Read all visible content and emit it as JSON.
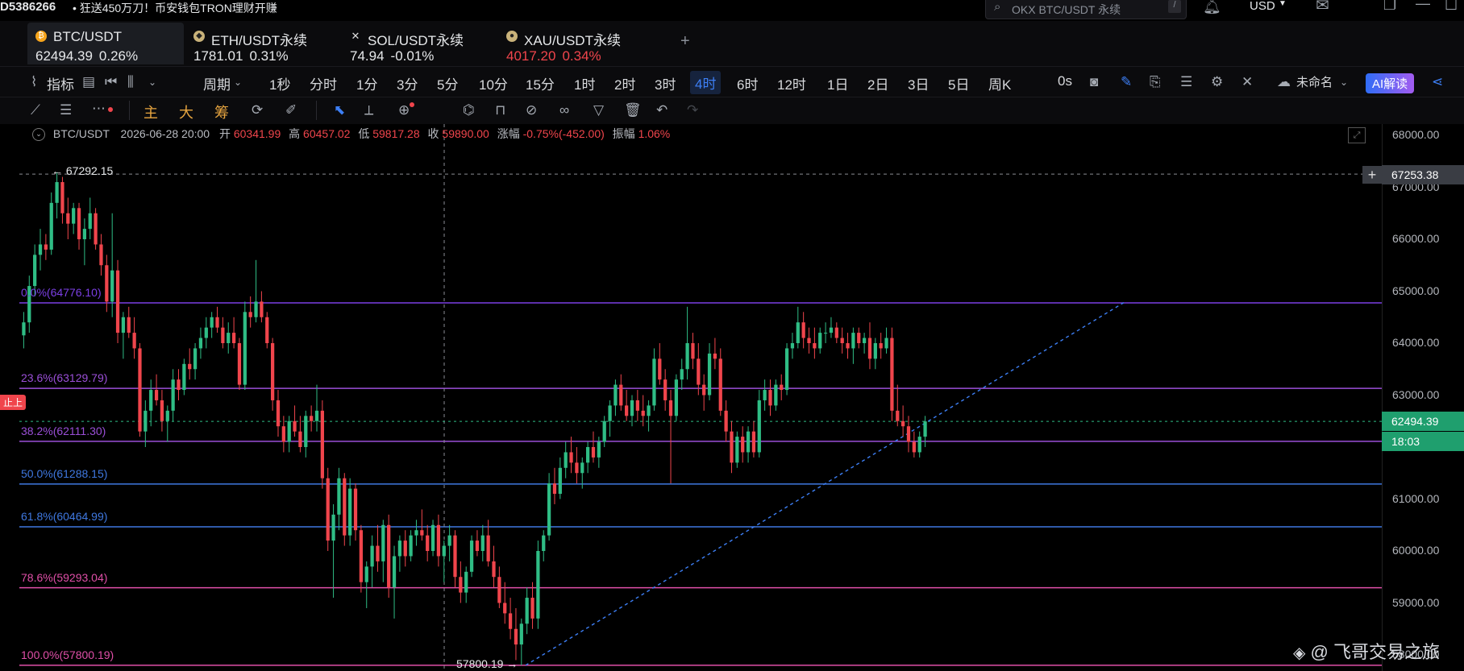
{
  "topbar": {
    "account_fragment": "D5386266",
    "promo": "• 狂送450万刀！币安钱包TRON理财开赚",
    "search_placeholder": "OKX BTC/USDT 永续",
    "search_shortcut": "/",
    "currency": "USD"
  },
  "tabs": [
    {
      "name": "BTC/USDT",
      "price": "62494.39",
      "change": "0.26%",
      "change_color": "#2fbd85",
      "active": true
    },
    {
      "name": "ETH/USDT永续",
      "price": "1781.01",
      "change": "0.31%",
      "change_color": "#2fbd85",
      "active": false
    },
    {
      "name": "SOL/USDT永续",
      "price": "74.94",
      "change": "-0.01%",
      "change_color": "#f0454c",
      "active": false
    },
    {
      "name": "XAU/USDT永续",
      "price": "4017.20",
      "change": "0.34%",
      "change_color": "#2fbd85",
      "active": false
    }
  ],
  "toolbar": {
    "indicators_label": "指标",
    "period_label": "周期",
    "timeframes": [
      "1秒",
      "分时",
      "1分",
      "3分",
      "5分",
      "10分",
      "15分",
      "1时",
      "2时",
      "3时",
      "4时",
      "6时",
      "12时",
      "1日",
      "2日",
      "3日",
      "5日",
      "周K"
    ],
    "active_timeframe": "4时",
    "countdown": "0s",
    "layout_name": "未命名",
    "ai_label": "AI解读",
    "drawing_labels": [
      "主",
      "大",
      "筹"
    ]
  },
  "infobar": {
    "symbol": "BTC/USDT",
    "datetime": "2026-06-28 20:00",
    "open_label": "开",
    "open": "60341.99",
    "high_label": "高",
    "high": "60457.02",
    "low_label": "低",
    "low": "59817.28",
    "close_label": "收",
    "close": "59890.00",
    "change_label": "涨幅",
    "change": "-0.75%(-452.00)",
    "amplitude_label": "振幅",
    "amplitude": "1.06%"
  },
  "chart_annotations": {
    "high_marker": "67292.15",
    "low_marker": "57800.19",
    "crosshair_price": "67253.38",
    "last_price": "62494.39",
    "countdown": "18:03",
    "side_badge": "止上",
    "watermark": "@ 飞哥交易之旅"
  },
  "fib_levels": [
    {
      "label": "0.0%(64776.10)",
      "price": 64776.1,
      "color": "#7b3fe4"
    },
    {
      "label": "23.6%(63129.79)",
      "price": 63129.79,
      "color": "#9b4fd8"
    },
    {
      "label": "38.2%(62111.30)",
      "price": 62111.3,
      "color": "#9b4fd8"
    },
    {
      "label": "50.0%(61288.15)",
      "price": 61288.15,
      "color": "#3f78e0"
    },
    {
      "label": "61.8%(60464.99)",
      "price": 60464.99,
      "color": "#3f78e0"
    },
    {
      "label": "78.6%(59293.04)",
      "price": 59293.04,
      "color": "#e04fa8"
    },
    {
      "label": "100.0%(57800.19)",
      "price": 57800.19,
      "color": "#e04fa8"
    }
  ],
  "price_axis": [
    "68000.00",
    "67000.00",
    "66000.00",
    "65000.00",
    "64000.00",
    "63000.00",
    "62000.00",
    "61000.00",
    "60000.00",
    "59000.00",
    "58000.00"
  ],
  "colors": {
    "up": "#2fbd85",
    "down": "#f0454c",
    "accent": "#3d7ff5"
  },
  "candles": [
    [
      64150,
      64600,
      63900,
      64400
    ],
    [
      64400,
      65300,
      64200,
      65100
    ],
    [
      65100,
      65900,
      64900,
      65700
    ],
    [
      65700,
      66200,
      65400,
      65900
    ],
    [
      65900,
      66100,
      65600,
      65800
    ],
    [
      65800,
      66900,
      65700,
      66700
    ],
    [
      66700,
      67292,
      66400,
      67100
    ],
    [
      67100,
      67200,
      66300,
      66500
    ],
    [
      66500,
      66800,
      66000,
      66300
    ],
    [
      66300,
      66700,
      66100,
      66600
    ],
    [
      66600,
      66700,
      65800,
      66000
    ],
    [
      66000,
      66400,
      65500,
      66200
    ],
    [
      66200,
      66800,
      66000,
      66500
    ],
    [
      66500,
      66600,
      65800,
      65900
    ],
    [
      65900,
      66100,
      65300,
      65500
    ],
    [
      65500,
      65700,
      64600,
      64800
    ],
    [
      64800,
      66500,
      64500,
      65400
    ],
    [
      65400,
      65600,
      64000,
      64200
    ],
    [
      64200,
      64600,
      63700,
      64500
    ],
    [
      64500,
      64700,
      64100,
      64200
    ],
    [
      64200,
      64500,
      63700,
      63900
    ],
    [
      63900,
      64000,
      62200,
      62300
    ],
    [
      62300,
      62900,
      62000,
      62700
    ],
    [
      62700,
      63300,
      62400,
      63100
    ],
    [
      63100,
      63400,
      62800,
      62900
    ],
    [
      62900,
      63100,
      62300,
      62500
    ],
    [
      62500,
      62800,
      62100,
      62700
    ],
    [
      62700,
      63500,
      62500,
      63300
    ],
    [
      63300,
      63500,
      62900,
      63100
    ],
    [
      63100,
      63700,
      63000,
      63600
    ],
    [
      63600,
      63900,
      63300,
      63500
    ],
    [
      63500,
      64000,
      63300,
      63900
    ],
    [
      63900,
      64300,
      63700,
      64100
    ],
    [
      64100,
      64500,
      63900,
      64300
    ],
    [
      64300,
      64600,
      64100,
      64500
    ],
    [
      64500,
      64700,
      64200,
      64300
    ],
    [
      64300,
      64500,
      63900,
      64000
    ],
    [
      64000,
      64400,
      63800,
      64200
    ],
    [
      64200,
      64500,
      63900,
      64000
    ],
    [
      64000,
      64100,
      63100,
      63200
    ],
    [
      63200,
      64800,
      63100,
      64600
    ],
    [
      64600,
      64900,
      64300,
      64500
    ],
    [
      64500,
      65600,
      64400,
      64800
    ],
    [
      64800,
      65000,
      64400,
      64500
    ],
    [
      64500,
      64600,
      63900,
      64000
    ],
    [
      64000,
      64100,
      62700,
      62900
    ],
    [
      62900,
      63100,
      62200,
      62400
    ],
    [
      62400,
      62600,
      61900,
      62100
    ],
    [
      62100,
      62600,
      61900,
      62500
    ],
    [
      62500,
      62800,
      62200,
      62300
    ],
    [
      62300,
      62600,
      61900,
      62000
    ],
    [
      62000,
      62700,
      61800,
      62600
    ],
    [
      62600,
      62800,
      62300,
      62500
    ],
    [
      62500,
      63200,
      62300,
      62700
    ],
    [
      62700,
      62900,
      61200,
      61400
    ],
    [
      61400,
      61600,
      60000,
      60200
    ],
    [
      60200,
      60900,
      59100,
      60700
    ],
    [
      60700,
      61600,
      60400,
      61400
    ],
    [
      61400,
      61500,
      60100,
      60300
    ],
    [
      60300,
      61400,
      60100,
      61200
    ],
    [
      61200,
      61300,
      60200,
      60400
    ],
    [
      60400,
      60500,
      59200,
      59400
    ],
    [
      59400,
      59800,
      58900,
      59700
    ],
    [
      59700,
      60300,
      59300,
      60100
    ],
    [
      60100,
      60500,
      59600,
      59800
    ],
    [
      59800,
      60600,
      59400,
      60500
    ],
    [
      60500,
      60700,
      59100,
      59300
    ],
    [
      59300,
      60100,
      58700,
      59900
    ],
    [
      59900,
      60300,
      59600,
      60200
    ],
    [
      60200,
      60400,
      59700,
      59900
    ],
    [
      59900,
      60400,
      59800,
      60300
    ],
    [
      60300,
      60600,
      60100,
      60400
    ],
    [
      60400,
      60800,
      60200,
      60300
    ],
    [
      60300,
      60500,
      59800,
      60000
    ],
    [
      60000,
      60600,
      59900,
      60500
    ],
    [
      60500,
      60700,
      59700,
      59900
    ],
    [
      59900,
      60200,
      59400,
      60100
    ],
    [
      60100,
      60500,
      59800,
      60300
    ],
    [
      60300,
      60400,
      59300,
      59500
    ],
    [
      59500,
      59800,
      59000,
      59200
    ],
    [
      59200,
      59700,
      59000,
      59600
    ],
    [
      59600,
      60300,
      59500,
      60200
    ],
    [
      60200,
      60400,
      59900,
      60000
    ],
    [
      60000,
      60500,
      59800,
      60300
    ],
    [
      60300,
      60600,
      59700,
      59800
    ],
    [
      59800,
      60100,
      59300,
      59500
    ],
    [
      59500,
      59700,
      58900,
      59000
    ],
    [
      59000,
      59400,
      58600,
      58800
    ],
    [
      58800,
      59100,
      58300,
      58500
    ],
    [
      58500,
      58900,
      57900,
      58200
    ],
    [
      58200,
      58700,
      57800,
      58600
    ],
    [
      58600,
      59300,
      58400,
      59100
    ],
    [
      59100,
      59400,
      58500,
      58700
    ],
    [
      58700,
      60200,
      58500,
      60000
    ],
    [
      60000,
      60400,
      59800,
      60300
    ],
    [
      60300,
      61500,
      60200,
      61300
    ],
    [
      61300,
      61600,
      60900,
      61100
    ],
    [
      61100,
      61800,
      61000,
      61600
    ],
    [
      61600,
      62100,
      61400,
      61900
    ],
    [
      61900,
      62200,
      61500,
      61700
    ],
    [
      61700,
      62000,
      61300,
      61500
    ],
    [
      61500,
      61800,
      61200,
      61700
    ],
    [
      61700,
      62100,
      61500,
      62000
    ],
    [
      62000,
      62300,
      61700,
      61800
    ],
    [
      61800,
      62200,
      61600,
      62100
    ],
    [
      62100,
      62600,
      62000,
      62500
    ],
    [
      62500,
      62900,
      62200,
      62800
    ],
    [
      62800,
      63300,
      62600,
      63200
    ],
    [
      63200,
      63400,
      62700,
      62800
    ],
    [
      62800,
      63100,
      62500,
      62600
    ],
    [
      62600,
      63000,
      62400,
      62900
    ],
    [
      62900,
      63100,
      62500,
      62700
    ],
    [
      62700,
      63000,
      62400,
      62600
    ],
    [
      62600,
      62900,
      62300,
      62800
    ],
    [
      62800,
      63900,
      62700,
      63700
    ],
    [
      63700,
      64000,
      63200,
      63300
    ],
    [
      63300,
      63500,
      62700,
      62900
    ],
    [
      62900,
      63100,
      61300,
      62600
    ],
    [
      62600,
      63400,
      62500,
      63300
    ],
    [
      63300,
      63700,
      63100,
      63500
    ],
    [
      63500,
      64700,
      63300,
      64000
    ],
    [
      64000,
      64200,
      63500,
      63700
    ],
    [
      63700,
      64000,
      63000,
      63200
    ],
    [
      63200,
      63400,
      62700,
      63000
    ],
    [
      63000,
      64000,
      62900,
      63800
    ],
    [
      63800,
      64100,
      63500,
      63700
    ],
    [
      63700,
      63900,
      62600,
      62700
    ],
    [
      62700,
      62900,
      62100,
      62300
    ],
    [
      62300,
      62500,
      61500,
      61700
    ],
    [
      61700,
      62300,
      61600,
      62200
    ],
    [
      62200,
      62400,
      61700,
      61900
    ],
    [
      61900,
      62400,
      61700,
      62300
    ],
    [
      62300,
      62500,
      61800,
      61900
    ],
    [
      61900,
      63100,
      61800,
      62900
    ],
    [
      62900,
      63300,
      62700,
      63100
    ],
    [
      63100,
      63300,
      62600,
      62800
    ],
    [
      62800,
      63300,
      62700,
      63200
    ],
    [
      63200,
      63400,
      62900,
      63100
    ],
    [
      63100,
      64000,
      63000,
      63900
    ],
    [
      63900,
      64200,
      63700,
      64000
    ],
    [
      64000,
      64700,
      63900,
      64400
    ],
    [
      64400,
      64600,
      63900,
      64100
    ],
    [
      64100,
      64300,
      63800,
      64000
    ],
    [
      64000,
      64300,
      63700,
      63900
    ],
    [
      63900,
      64300,
      63800,
      64200
    ],
    [
      64200,
      64400,
      64000,
      64200
    ],
    [
      64200,
      64500,
      64100,
      64300
    ],
    [
      64300,
      64400,
      64000,
      64100
    ],
    [
      64100,
      64300,
      63800,
      64000
    ],
    [
      64000,
      64200,
      63700,
      63900
    ],
    [
      63900,
      64300,
      63600,
      64200
    ],
    [
      64200,
      64300,
      63900,
      64000
    ],
    [
      64000,
      64200,
      63800,
      64100
    ],
    [
      64100,
      64400,
      63500,
      63700
    ],
    [
      63700,
      64100,
      63500,
      64000
    ],
    [
      64000,
      64200,
      63700,
      63900
    ],
    [
      63900,
      64300,
      63800,
      64100
    ],
    [
      64100,
      64300,
      62500,
      62700
    ],
    [
      62700,
      63200,
      62400,
      62500
    ],
    [
      62500,
      62800,
      62200,
      62400
    ],
    [
      62400,
      62600,
      61900,
      62100
    ],
    [
      62100,
      62300,
      61800,
      61900
    ],
    [
      61900,
      62300,
      61800,
      62200
    ],
    [
      62200,
      62600,
      62000,
      62494
    ]
  ]
}
